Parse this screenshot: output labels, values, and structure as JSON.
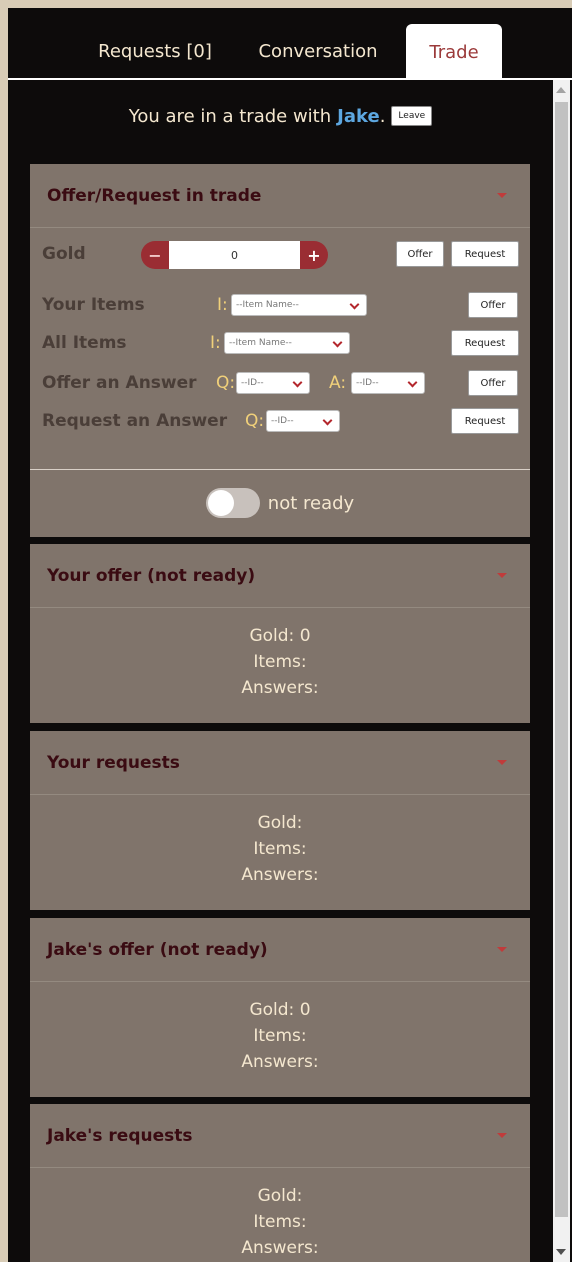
{
  "tabs": [
    {
      "label": "Requests [0]"
    },
    {
      "label": "Conversation"
    },
    {
      "label": "Trade"
    }
  ],
  "trade": {
    "prefix": "You are in a trade with",
    "partner": "Jake",
    "suffix": ".",
    "leave_label": "Leave"
  },
  "offer_panel": {
    "title": "Offer/Request in trade",
    "gold": {
      "label": "Gold",
      "value": "0",
      "minus": "−",
      "plus": "+",
      "offer": "Offer",
      "request": "Request"
    },
    "your_items": {
      "label": "Your Items",
      "prefix": "I:",
      "placeholder": "--Item Name--",
      "button": "Offer"
    },
    "all_items": {
      "label": "All Items",
      "prefix": "I:",
      "placeholder": "--Item Name--",
      "button": "Request"
    },
    "offer_answer": {
      "label": "Offer an Answer",
      "q": "Q:",
      "q_placeholder": "--ID--",
      "a": "A:",
      "a_placeholder": "--ID--",
      "button": "Offer"
    },
    "request_answer": {
      "label": "Request an Answer",
      "q": "Q:",
      "q_placeholder": "--ID--",
      "button": "Request"
    },
    "ready_label": "not ready"
  },
  "summaries": [
    {
      "title": "Your offer (not ready)",
      "gold": "Gold: 0",
      "items": "Items:",
      "answers": "Answers:"
    },
    {
      "title": "Your requests",
      "gold": "Gold:",
      "items": "Items:",
      "answers": "Answers:"
    },
    {
      "title": "Jake's offer (not ready)",
      "gold": "Gold: 0",
      "items": "Items:",
      "answers": "Answers:"
    },
    {
      "title": "Jake's requests",
      "gold": "Gold:",
      "items": "Items:",
      "answers": "Answers:"
    }
  ],
  "colors": {
    "accent": "#9b3a3a",
    "panel": "#80746b",
    "partner": "#5da7e0",
    "background": "#0d0b0b"
  }
}
